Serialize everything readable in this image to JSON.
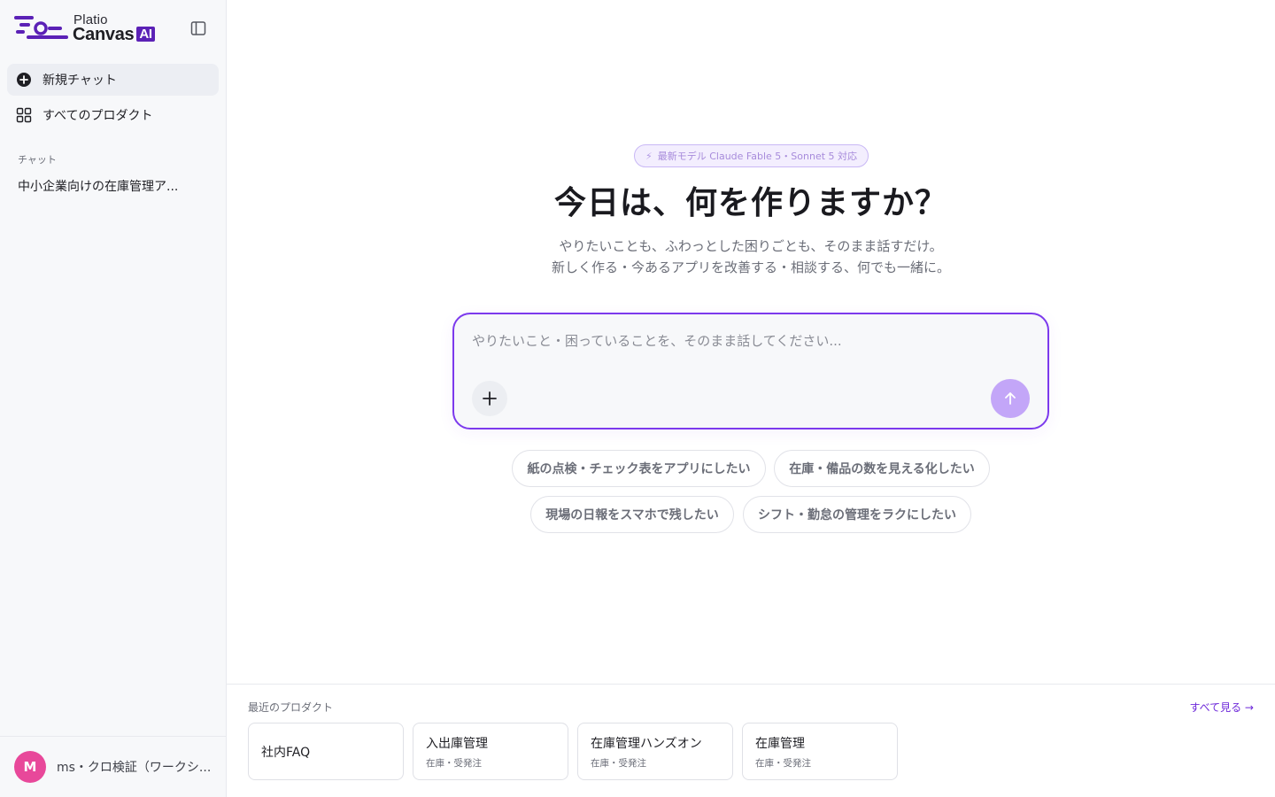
{
  "brand": {
    "name_top": "Platio",
    "name_bottom": "Canvas",
    "ai_badge": "AI",
    "accent_color": "#7c3aed"
  },
  "sidebar": {
    "toggle_icon": "sidebar-panel-icon",
    "nav": [
      {
        "label": "新規チャット",
        "icon": "plus-circle-icon",
        "active": true
      },
      {
        "label": "すべてのプロダクト",
        "icon": "grid-icon",
        "active": false
      }
    ],
    "section_label": "チャット",
    "chats": [
      {
        "title": "中小企業向けの在庫管理ア..."
      }
    ],
    "user": {
      "initial": "M",
      "name": "ms・クロ検証（ワークシ...",
      "avatar_color": "#e8489a"
    }
  },
  "main": {
    "badge": "最新モデル Claude Fable 5・Sonnet 5 対応",
    "headline": "今日は、何を作りますか？",
    "subline_1": "やりたいことも、ふわっとした困りごとも、そのまま話すだけ。",
    "subline_2": "新しく作る・今あるアプリを改善する・相談する、何でも一緒に。",
    "composer": {
      "placeholder": "やりたいこと・困っていることを、そのまま話してください...",
      "value": "",
      "attach_icon": "plus-icon",
      "send_icon": "arrow-up-icon"
    },
    "suggestions": [
      "紙の点検・チェック表をアプリにしたい",
      "在庫・備品の数を見える化したい",
      "現場の日報をスマホで残したい",
      "シフト・勤怠の管理をラクにしたい"
    ]
  },
  "recent": {
    "title": "最近のプロダクト",
    "see_all": "すべて見る →",
    "products": [
      {
        "name": "社内FAQ",
        "category": ""
      },
      {
        "name": "入出庫管理",
        "category": "在庫・受発注"
      },
      {
        "name": "在庫管理ハンズオン",
        "category": "在庫・受発注"
      },
      {
        "name": "在庫管理",
        "category": "在庫・受発注"
      }
    ]
  }
}
